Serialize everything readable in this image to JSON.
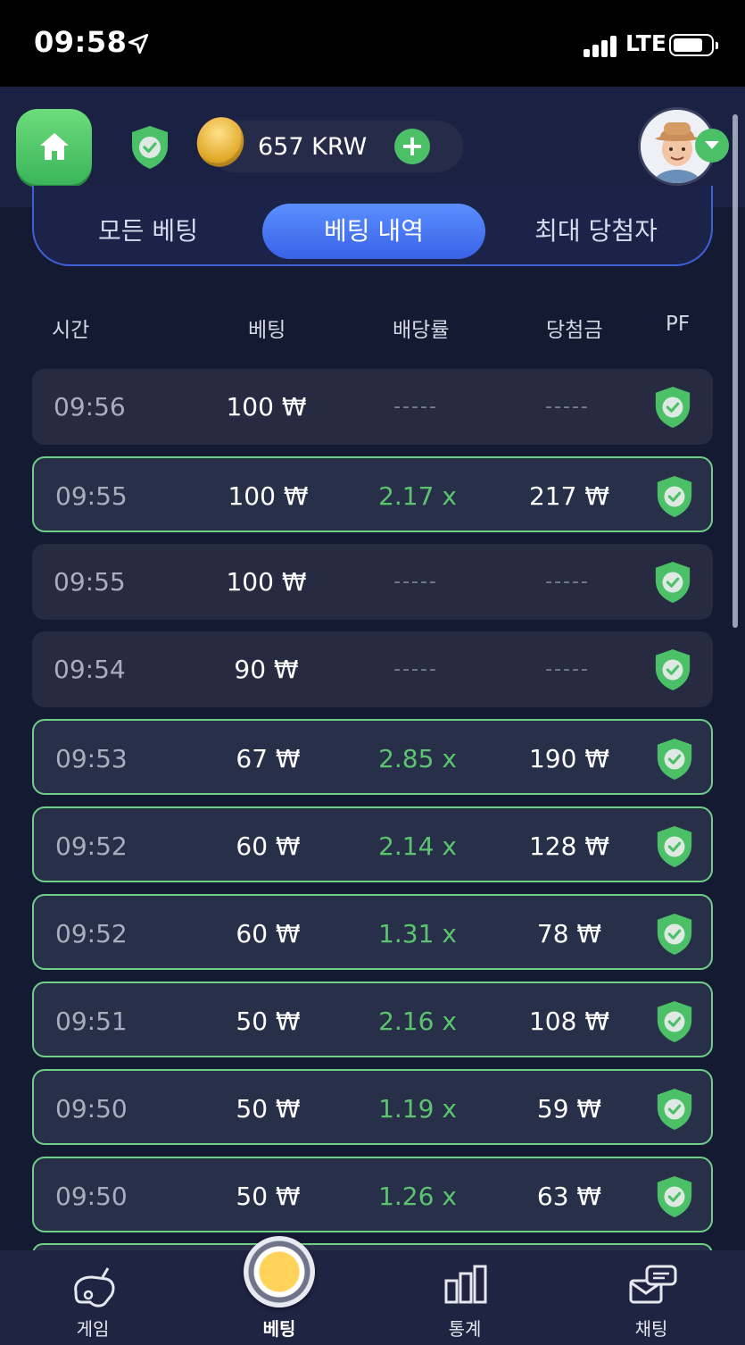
{
  "status_bar": {
    "time": "09:58",
    "network": "LTE"
  },
  "header": {
    "balance": "657 KRW",
    "add_icon": "plus-icon"
  },
  "tabs": [
    {
      "label": "모든 베팅",
      "active": false
    },
    {
      "label": "베팅 내역",
      "active": true
    },
    {
      "label": "최대 당첨자",
      "active": false
    }
  ],
  "columns": {
    "time": "시간",
    "bet": "베팅",
    "multiplier": "배당률",
    "winnings": "당첨금",
    "pf": "PF"
  },
  "rows": [
    {
      "time": "09:56",
      "bet": "100 ₩",
      "multiplier": "-----",
      "winnings": "-----",
      "win": false
    },
    {
      "time": "09:55",
      "bet": "100 ₩",
      "multiplier": "2.17 x",
      "winnings": "217 ₩",
      "win": true
    },
    {
      "time": "09:55",
      "bet": "100 ₩",
      "multiplier": "-----",
      "winnings": "-----",
      "win": false
    },
    {
      "time": "09:54",
      "bet": "90 ₩",
      "multiplier": "-----",
      "winnings": "-----",
      "win": false
    },
    {
      "time": "09:53",
      "bet": "67 ₩",
      "multiplier": "2.85 x",
      "winnings": "190 ₩",
      "win": true
    },
    {
      "time": "09:52",
      "bet": "60 ₩",
      "multiplier": "2.14 x",
      "winnings": "128 ₩",
      "win": true
    },
    {
      "time": "09:52",
      "bet": "60 ₩",
      "multiplier": "1.31 x",
      "winnings": "78 ₩",
      "win": true
    },
    {
      "time": "09:51",
      "bet": "50 ₩",
      "multiplier": "2.16 x",
      "winnings": "108 ₩",
      "win": true
    },
    {
      "time": "09:50",
      "bet": "50 ₩",
      "multiplier": "1.19 x",
      "winnings": "59 ₩",
      "win": true
    },
    {
      "time": "09:50",
      "bet": "50 ₩",
      "multiplier": "1.26 x",
      "winnings": "63 ₩",
      "win": true
    }
  ],
  "bottom_nav": [
    {
      "label": "게임",
      "icon": "gamepad-icon"
    },
    {
      "label": "베팅",
      "icon": "chip-icon"
    },
    {
      "label": "통계",
      "icon": "stats-icon"
    },
    {
      "label": "채팅",
      "icon": "chat-icon"
    }
  ],
  "colors": {
    "win_green": "#5cc46f",
    "accent_blue": "#3f5fd6",
    "row_bg": "#262b41"
  }
}
